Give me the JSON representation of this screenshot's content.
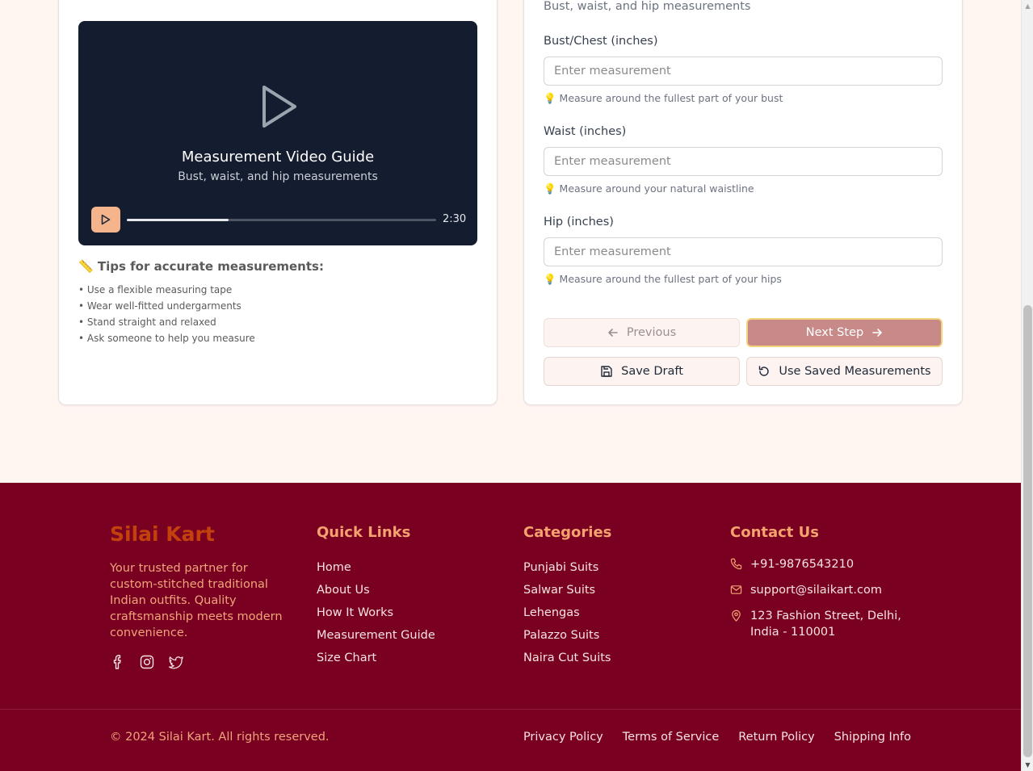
{
  "video": {
    "title": "Measurement Video Guide",
    "subtitle": "Bust, waist, and hip measurements",
    "time": "2:30",
    "progress_fraction": 0.33
  },
  "tips": {
    "heading": "📏 Tips for accurate measurements:",
    "items": [
      "• Use a flexible measuring tape",
      "• Wear well-fitted undergarments",
      "• Stand straight and relaxed",
      "• Ask someone to help you measure"
    ]
  },
  "form": {
    "section_subtitle": "Bust, waist, and hip measurements",
    "fields": [
      {
        "label": "Bust/Chest (inches)",
        "placeholder": "Enter measurement",
        "hint": "💡 Measure around the fullest part of your bust"
      },
      {
        "label": "Waist (inches)",
        "placeholder": "Enter measurement",
        "hint": "💡 Measure around your natural waistline"
      },
      {
        "label": "Hip (inches)",
        "placeholder": "Enter measurement",
        "hint": "💡 Measure around the fullest part of your hips"
      }
    ],
    "buttons": {
      "previous": "Previous",
      "next": "Next Step",
      "save_draft": "Save Draft",
      "use_saved": "Use Saved Measurements"
    }
  },
  "footer": {
    "brand": "Silai Kart",
    "description": "Your trusted partner for custom-stitched traditional Indian outfits. Quality craftsmanship meets modern convenience.",
    "quick_links": {
      "heading": "Quick Links",
      "items": [
        "Home",
        "About Us",
        "How It Works",
        "Measurement Guide",
        "Size Chart"
      ]
    },
    "categories": {
      "heading": "Categories",
      "items": [
        "Punjabi Suits",
        "Salwar Suits",
        "Lehengas",
        "Palazzo Suits",
        "Naira Cut Suits"
      ]
    },
    "contact": {
      "heading": "Contact Us",
      "phone": "+91-9876543210",
      "email": "support@silaikart.com",
      "address": "123 Fashion Street, Delhi, India - 110001"
    },
    "copyright": "© 2024 Silai Kart. All rights reserved.",
    "legal": [
      "Privacy Policy",
      "Terms of Service",
      "Return Policy",
      "Shipping Info"
    ]
  },
  "colors": {
    "footer_bg": "#7a0022",
    "accent": "#f4a36f",
    "next_button": "#c88a88"
  }
}
